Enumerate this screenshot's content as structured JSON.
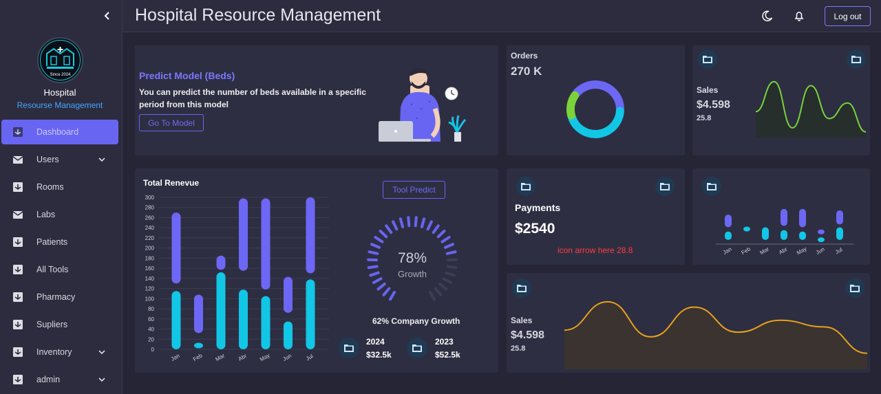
{
  "header": {
    "title": "Hospital Resource Management",
    "logout_label": "Log out"
  },
  "brand": {
    "name": "Hospital",
    "subtitle": "Resourse Management",
    "logo_text": "Since 2024"
  },
  "sidebar": {
    "items": [
      {
        "label": "Dashboard",
        "active": true,
        "icon": "inbox-icon",
        "expandable": false
      },
      {
        "label": "Users",
        "active": false,
        "icon": "mail-icon",
        "expandable": true
      },
      {
        "label": "Rooms",
        "active": false,
        "icon": "inbox-icon",
        "expandable": false
      },
      {
        "label": "Labs",
        "active": false,
        "icon": "mail-icon",
        "expandable": false
      },
      {
        "label": "Patients",
        "active": false,
        "icon": "inbox-icon",
        "expandable": false
      },
      {
        "label": "All Tools",
        "active": false,
        "icon": "inbox-icon",
        "expandable": false
      },
      {
        "label": "Pharmacy",
        "active": false,
        "icon": "inbox-icon",
        "expandable": false
      },
      {
        "label": "Supliers",
        "active": false,
        "icon": "inbox-icon",
        "expandable": false
      },
      {
        "label": "Inventory",
        "active": false,
        "icon": "inbox-icon",
        "expandable": true
      },
      {
        "label": "admin",
        "active": false,
        "icon": "inbox-icon",
        "expandable": true
      }
    ]
  },
  "predict": {
    "title": "Predict Model (Beds)",
    "text": "You can predict the number of beds available in a specific period from this model",
    "button": "Go To Model"
  },
  "orders": {
    "label": "Orders",
    "value": "270 K"
  },
  "sales_top": {
    "label": "Sales",
    "value": "$4.598",
    "sub": "25.8"
  },
  "payments": {
    "label": "Payments",
    "value": "$2540",
    "note": "icon arrow here 28.8"
  },
  "sales_bottom": {
    "label": "Sales",
    "value": "$4.598",
    "sub": "25.8"
  },
  "revenue": {
    "title": "Total Renevue",
    "button": "Tool Predict",
    "gauge_value": "78%",
    "gauge_label": "Growth",
    "company_growth": "62% Company Growth",
    "years": [
      {
        "year": "2024",
        "amount": "$32.5k"
      },
      {
        "year": "2023",
        "amount": "$52.5k"
      }
    ]
  },
  "colors": {
    "accent": "#6865f2",
    "cyan": "#12c6e6",
    "green": "#7ad33a",
    "orange": "#e8a21c",
    "alert": "#ff3d3d"
  },
  "chart_data": [
    {
      "type": "bar",
      "title": "Total Renevue",
      "categories": [
        "Jan",
        "Feb",
        "Mar",
        "Abr",
        "May",
        "Jun",
        "Jul"
      ],
      "yticks": [
        0,
        20,
        40,
        60,
        80,
        100,
        120,
        140,
        160,
        180,
        200,
        220,
        240,
        260,
        280,
        300
      ],
      "ylim": [
        0,
        300
      ],
      "series": [
        {
          "color": "#12c6e6",
          "ranges": [
            [
              0,
              115
            ],
            [
              2,
              5
            ],
            [
              0,
              152
            ],
            [
              0,
              118
            ],
            [
              0,
              105
            ],
            [
              0,
              55
            ],
            [
              0,
              138
            ]
          ]
        },
        {
          "color": "#6d67f5",
          "ranges": [
            [
              130,
              270
            ],
            [
              32,
              108
            ],
            [
              157,
              185
            ],
            [
              155,
              298
            ],
            [
              118,
              298
            ],
            [
              72,
              143
            ],
            [
              150,
              300
            ]
          ]
        }
      ]
    },
    {
      "type": "pie",
      "title": "Orders",
      "values": [
        40,
        30,
        15,
        15
      ],
      "colors": [
        "#6d67f5",
        "#12c6e6",
        "#12c6e6",
        "#7ad33a"
      ]
    },
    {
      "type": "area",
      "title": "Sales",
      "values": [
        40,
        92,
        12,
        85,
        28,
        55,
        5
      ],
      "ylim": [
        0,
        100
      ],
      "color": "#7ad33a"
    },
    {
      "type": "bar",
      "title": "Payments",
      "categories": [
        "Jan",
        "Feb",
        "Mar",
        "Abr",
        "May",
        "Jun",
        "Jul"
      ],
      "ylim": [
        0,
        100
      ],
      "series": [
        {
          "color": "#12c6e6",
          "ranges": [
            [
              10,
              40
            ],
            [
              40,
              55
            ],
            [
              10,
              55
            ],
            [
              10,
              45
            ],
            [
              10,
              40
            ],
            [
              2,
              10
            ],
            [
              10,
              55
            ]
          ]
        },
        {
          "color": "#6d67f5",
          "ranges": [
            [
              55,
              100
            ],
            [
              0,
              0
            ],
            [
              0,
              0
            ],
            [
              60,
              120
            ],
            [
              55,
              120
            ],
            [
              30,
              45
            ],
            [
              65,
              115
            ]
          ]
        }
      ]
    },
    {
      "type": "area",
      "title": "Sales",
      "values": [
        55,
        98,
        45,
        90,
        52,
        70,
        60,
        20
      ],
      "ylim": [
        0,
        100
      ],
      "color": "#e8a21c"
    },
    {
      "type": "gauge",
      "value": 78,
      "max": 100
    }
  ]
}
